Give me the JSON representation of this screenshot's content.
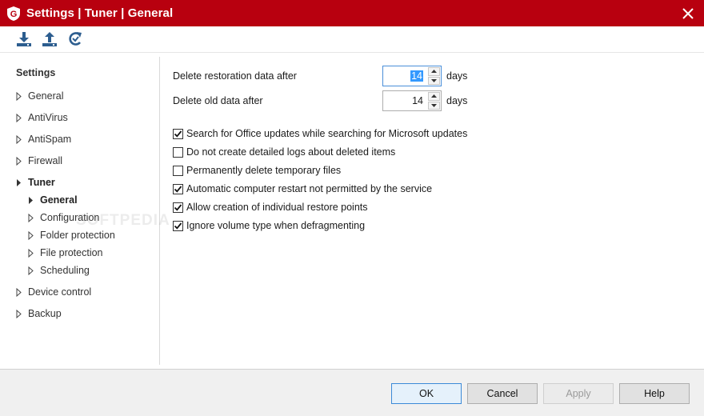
{
  "window": {
    "title": "Settings | Tuner | General",
    "accent_color": "#b8000f",
    "logo_letter": "G"
  },
  "toolbar": {
    "buttons": [
      {
        "icon": "download-icon"
      },
      {
        "icon": "upload-icon"
      },
      {
        "icon": "reset-icon"
      }
    ]
  },
  "sidebar": {
    "heading": "Settings",
    "items": [
      {
        "label": "General"
      },
      {
        "label": "AntiVirus"
      },
      {
        "label": "AntiSpam"
      },
      {
        "label": "Firewall"
      },
      {
        "label": "Tuner",
        "expanded": true,
        "selected": true
      },
      {
        "label": "General",
        "child": true,
        "selected": true
      },
      {
        "label": "Configuration",
        "child": true
      },
      {
        "label": "Folder protection",
        "child": true
      },
      {
        "label": "File protection",
        "child": true
      },
      {
        "label": "Scheduling",
        "child": true
      },
      {
        "label": "Device control"
      },
      {
        "label": "Backup"
      }
    ]
  },
  "content": {
    "fields": [
      {
        "label": "Delete restoration data after",
        "value": "14",
        "unit": "days",
        "focused": true
      },
      {
        "label": "Delete old data after",
        "value": "14",
        "unit": "days",
        "focused": false
      }
    ],
    "checkboxes": [
      {
        "label": "Search for Office updates while searching for Microsoft updates",
        "checked": true
      },
      {
        "label": "Do not create detailed logs about deleted items",
        "checked": false
      },
      {
        "label": "Permanently delete temporary files",
        "checked": false
      },
      {
        "label": "Automatic computer restart not permitted by the service",
        "checked": true
      },
      {
        "label": "Allow creation of individual restore points",
        "checked": true
      },
      {
        "label": "Ignore volume type when defragmenting",
        "checked": true
      }
    ]
  },
  "footer": {
    "ok_label": "OK",
    "cancel_label": "Cancel",
    "apply_label": "Apply",
    "help_label": "Help"
  },
  "watermark": "SOFTPEDIA"
}
